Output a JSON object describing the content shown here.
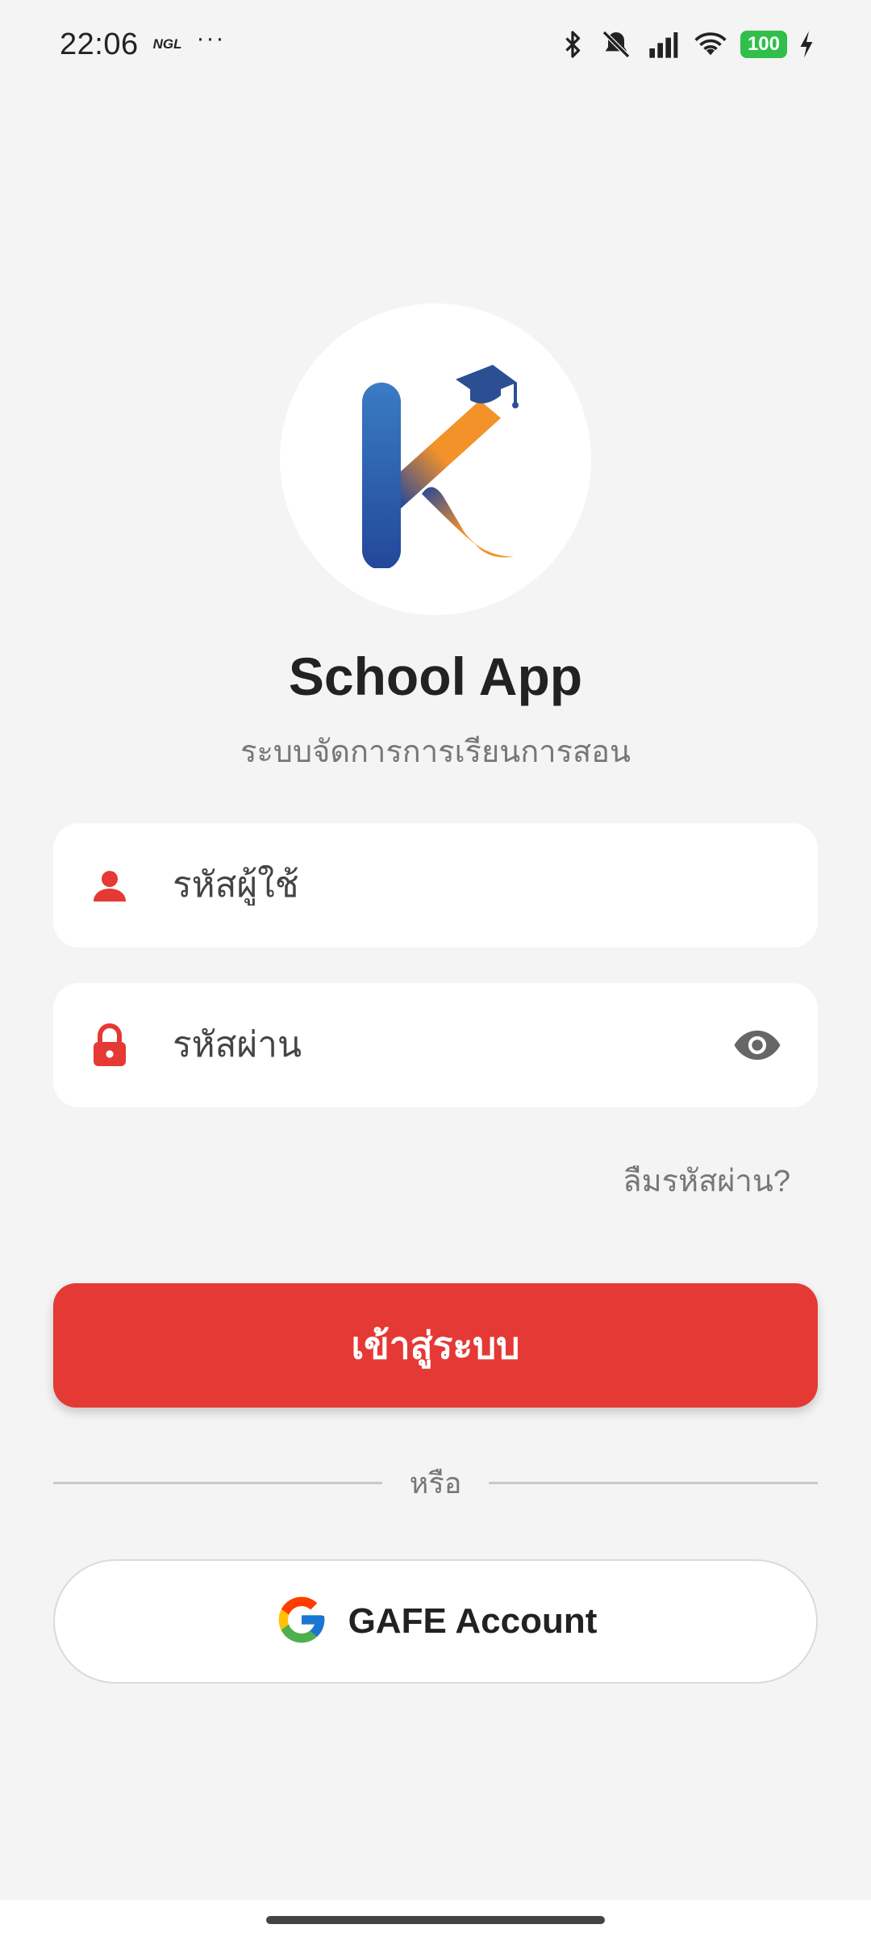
{
  "status_bar": {
    "time": "22:06",
    "carrier_tag": "NGL",
    "more": "···",
    "battery": "100"
  },
  "app": {
    "title": "School App",
    "subtitle": "ระบบจัดการการเรียนการสอน",
    "logo_icon": "k-graduation-cap-logo"
  },
  "form": {
    "username_placeholder": "รหัสผู้ใช้",
    "password_placeholder": "รหัสผ่าน",
    "forgot_password": "ลืมรหัสผ่าน?",
    "login_label": "เข้าสู่ระบบ",
    "or_label": "หรือ",
    "gafe_label": "GAFE Account"
  },
  "colors": {
    "accent": "#e53935",
    "background": "#f4f4f4",
    "logo_blue": "#2a5aa8",
    "logo_orange": "#f4922a"
  }
}
